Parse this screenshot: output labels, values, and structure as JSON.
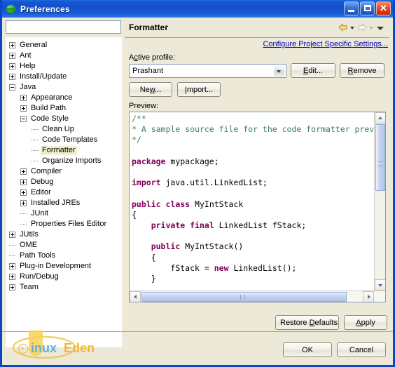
{
  "window": {
    "title": "Preferences",
    "icon": "globe-icon",
    "controls": {
      "minimize": "_",
      "maximize": "□",
      "close": "✕"
    }
  },
  "sidebar": {
    "filter": {
      "value": "",
      "placeholder": ""
    },
    "tree": [
      {
        "label": "General",
        "depth": 0,
        "state": "collapsed",
        "selected": false
      },
      {
        "label": "Ant",
        "depth": 0,
        "state": "collapsed",
        "selected": false
      },
      {
        "label": "Help",
        "depth": 0,
        "state": "collapsed",
        "selected": false
      },
      {
        "label": "Install/Update",
        "depth": 0,
        "state": "collapsed",
        "selected": false
      },
      {
        "label": "Java",
        "depth": 0,
        "state": "expanded",
        "selected": false
      },
      {
        "label": "Appearance",
        "depth": 1,
        "state": "collapsed",
        "selected": false
      },
      {
        "label": "Build Path",
        "depth": 1,
        "state": "collapsed",
        "selected": false
      },
      {
        "label": "Code Style",
        "depth": 1,
        "state": "expanded",
        "selected": false
      },
      {
        "label": "Clean Up",
        "depth": 2,
        "state": "leaf",
        "selected": false
      },
      {
        "label": "Code Templates",
        "depth": 2,
        "state": "leaf",
        "selected": false
      },
      {
        "label": "Formatter",
        "depth": 2,
        "state": "leaf",
        "selected": true
      },
      {
        "label": "Organize Imports",
        "depth": 2,
        "state": "leaf",
        "selected": false
      },
      {
        "label": "Compiler",
        "depth": 1,
        "state": "collapsed",
        "selected": false
      },
      {
        "label": "Debug",
        "depth": 1,
        "state": "collapsed",
        "selected": false
      },
      {
        "label": "Editor",
        "depth": 1,
        "state": "collapsed",
        "selected": false
      },
      {
        "label": "Installed JREs",
        "depth": 1,
        "state": "collapsed",
        "selected": false
      },
      {
        "label": "JUnit",
        "depth": 1,
        "state": "leaf",
        "selected": false
      },
      {
        "label": "Properties Files Editor",
        "depth": 1,
        "state": "leaf",
        "selected": false
      },
      {
        "label": "JUtils",
        "depth": 0,
        "state": "collapsed",
        "selected": false
      },
      {
        "label": "OME",
        "depth": 0,
        "state": "leaf",
        "selected": false
      },
      {
        "label": "Path Tools",
        "depth": 0,
        "state": "leaf",
        "selected": false
      },
      {
        "label": "Plug-in Development",
        "depth": 0,
        "state": "collapsed",
        "selected": false
      },
      {
        "label": "Run/Debug",
        "depth": 0,
        "state": "collapsed",
        "selected": false
      },
      {
        "label": "Team",
        "depth": 0,
        "state": "collapsed",
        "selected": false
      }
    ]
  },
  "page": {
    "title": "Formatter",
    "nav": {
      "back_icon": "back-arrow-icon",
      "forward_icon": "forward-arrow-icon",
      "menu_icon": "chevron-down-icon"
    },
    "project_link": "Configure Project Specific Settings...",
    "active_profile_label": "Active profile:",
    "active_profile_label_mnemonic": "A",
    "profile_value": "Prashant",
    "buttons": {
      "edit": "Edit...",
      "remove": "Remove",
      "new": "New...",
      "import": "Import...",
      "restore_defaults": "Restore Defaults",
      "apply": "Apply",
      "ok": "OK",
      "cancel": "Cancel"
    },
    "preview_label": "Preview:",
    "preview_code": [
      {
        "text": "/**",
        "type": "comment"
      },
      {
        "text": "* A sample source file for the code formatter prev",
        "type": "comment"
      },
      {
        "text": "*/",
        "type": "comment"
      },
      {
        "text": "",
        "type": "blank"
      },
      {
        "text": "package mypackage;",
        "type": "code",
        "keyword": "package"
      },
      {
        "text": "",
        "type": "blank"
      },
      {
        "text": "import java.util.LinkedList;",
        "type": "code",
        "keyword": "import"
      },
      {
        "text": "",
        "type": "blank"
      },
      {
        "text": "public class MyIntStack",
        "type": "code",
        "keyword": "public class"
      },
      {
        "text": "{",
        "type": "code"
      },
      {
        "text": "    private final LinkedList fStack;",
        "type": "code",
        "keyword": "private final"
      },
      {
        "text": "",
        "type": "blank"
      },
      {
        "text": "    public MyIntStack()",
        "type": "code",
        "keyword": "public"
      },
      {
        "text": "    {",
        "type": "code"
      },
      {
        "text": "        fStack = new LinkedList();",
        "type": "code",
        "keyword": "new"
      },
      {
        "text": "    }",
        "type": "code"
      }
    ],
    "scroll": {
      "vertical_position_pct": 0,
      "vertical_thumb_pct": 43,
      "horizontal_position_pct": 0,
      "horizontal_thumb_pct": 88
    }
  },
  "colors": {
    "title_bar": "#1350cc",
    "dialog_bg": "#ece9d8",
    "comment": "#3f7f5f",
    "keyword": "#7f0055",
    "link": "#0000c0",
    "selection": "#f0efd2"
  },
  "watermark": {
    "text_prefix": "inux",
    "text_suffix": "Eden",
    "full": "LinuxEden"
  }
}
